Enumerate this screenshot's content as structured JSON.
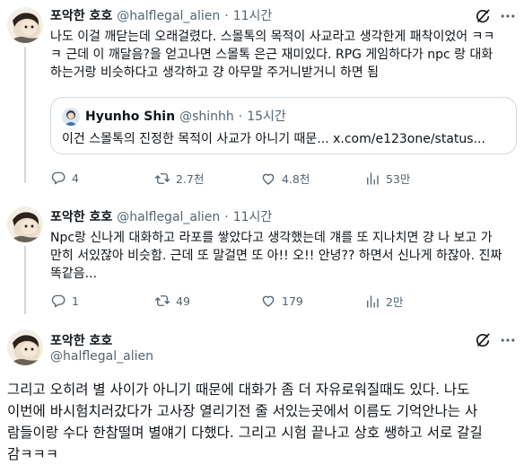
{
  "tweets": [
    {
      "author": "포악한 호호",
      "handle": "@halflegal_alien",
      "separator": "·",
      "time": "11시간",
      "text_lines": [
        "나도 이걸 깨닫는데 오래걸렸다. 스몰톡의 목적이 사교라고 생각한게 패착이었어 ㅋㅋ",
        "ㅋ 근데 이 깨달음?을 얻고나면 스몰톡 은근 재미있다. RPG 게임하다가 npc 랑 대화",
        "하는거랑 비슷하다고 생각하고 걍 아무말 주거니받거니 하면 됨"
      ],
      "quote": {
        "author": "Hyunho Shin",
        "handle": "@shinhh",
        "separator": "·",
        "time": "15시간",
        "text": "이건 스몰톡의 진정한 목적이 사교가 아니기 때문... x.com/e123one/status..."
      },
      "actions": {
        "replies": "4",
        "retweets": "2.7천",
        "likes": "4.8천",
        "views": "53만"
      }
    },
    {
      "author": "포악한 호호",
      "handle": "@halflegal_alien",
      "separator": "·",
      "time": "11시간",
      "text_lines": [
        "Npc랑 신나게 대화하고 라포를 쌓았다고 생각했는데 걔를 또 지나치면 걍 나 보고 가",
        "만히 서있잖아 비슷함. 근데 또 말걸면 또 아!! 오!! 안녕?? 하면서 신나게 하잖아. 진짜",
        "똑같음..."
      ],
      "actions": {
        "replies": "1",
        "retweets": "49",
        "likes": "179",
        "views": "2만"
      }
    }
  ],
  "main_tweet": {
    "author": "포악한 호호",
    "handle": "@halflegal_alien",
    "text_lines": [
      "그리고 오히려 별 사이가 아니기 때문에 대화가 좀 더 자유로워질때도 있다.  나도",
      "이번에 바시험치러갔다가 고사장 열리기전 줄 서있는곳에서 이름도 기억안나는 사",
      "람들이랑 수다 한참떨며 별얘기 다했다. 그리고 시험 끝나고 상호 쌩하고 서로 갈길",
      "감ㅋㅋㅋ"
    ]
  },
  "icons": {
    "grok": "grok-icon",
    "more": "more-icon",
    "reply": "reply-icon",
    "retweet": "retweet-icon",
    "like": "like-icon",
    "views": "views-icon"
  },
  "colors": {
    "text": "#0f1419",
    "muted": "#536471",
    "thread": "#cfd9de",
    "divider": "#eff3f4"
  }
}
